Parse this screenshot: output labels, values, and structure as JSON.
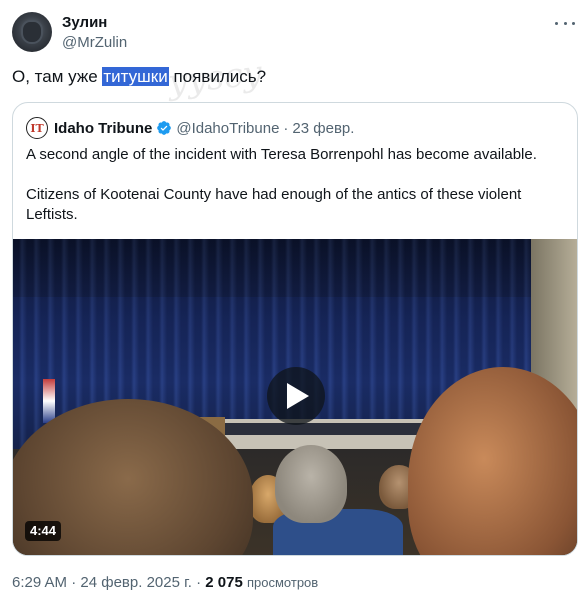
{
  "author": {
    "name": "Зулин",
    "handle": "@MrZulin"
  },
  "tweet": {
    "text_before": "О, там уже ",
    "highlighted": "титушки",
    "text_after": " появились?"
  },
  "quoted": {
    "logo_text": "IT",
    "name": "Idaho Tribune",
    "handle": "@IdahoTribune",
    "separator": "·",
    "date": "23 февр.",
    "paragraphs": [
      "A second angle of the incident with Teresa Borrenpohl has become available.",
      "Citizens of Kootenai County have had enough of the antics of these violent Leftists."
    ],
    "video": {
      "duration": "4:44"
    }
  },
  "meta": {
    "time": "6:29 AM",
    "separator": "·",
    "date": "24 февр. 2025 г.",
    "views_count": "2 075",
    "views_label": "просмотров"
  },
  "colors": {
    "verified": "#1d9bf0",
    "highlight": "#3367d6",
    "secondary_text": "#536471"
  },
  "icons": {
    "more": "more-dots-icon",
    "verified": "verified-badge-icon",
    "play": "play-icon"
  }
}
